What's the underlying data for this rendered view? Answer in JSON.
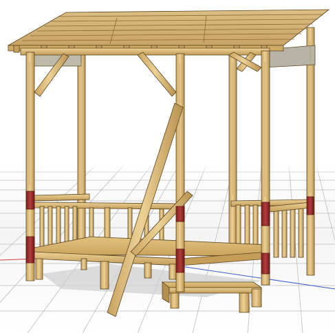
{
  "viewport": {
    "kind": "3d-model-viewport",
    "model": "wooden-pergola-play-deck",
    "background_color": "#ffffff",
    "grid_color": "#b9b9b9",
    "axis_x_color": "#d23a3a",
    "axis_y_color": "#3a5ad2"
  },
  "palette": {
    "wood_light": "#e6c98a",
    "wood_mid": "#d3ae67",
    "wood_dark": "#a9854a",
    "wood_edge": "#5b4520",
    "bracket_red": "#9c2d2d",
    "bracket_dark": "#5e1616",
    "panel_gray": "#b7b3a6"
  }
}
